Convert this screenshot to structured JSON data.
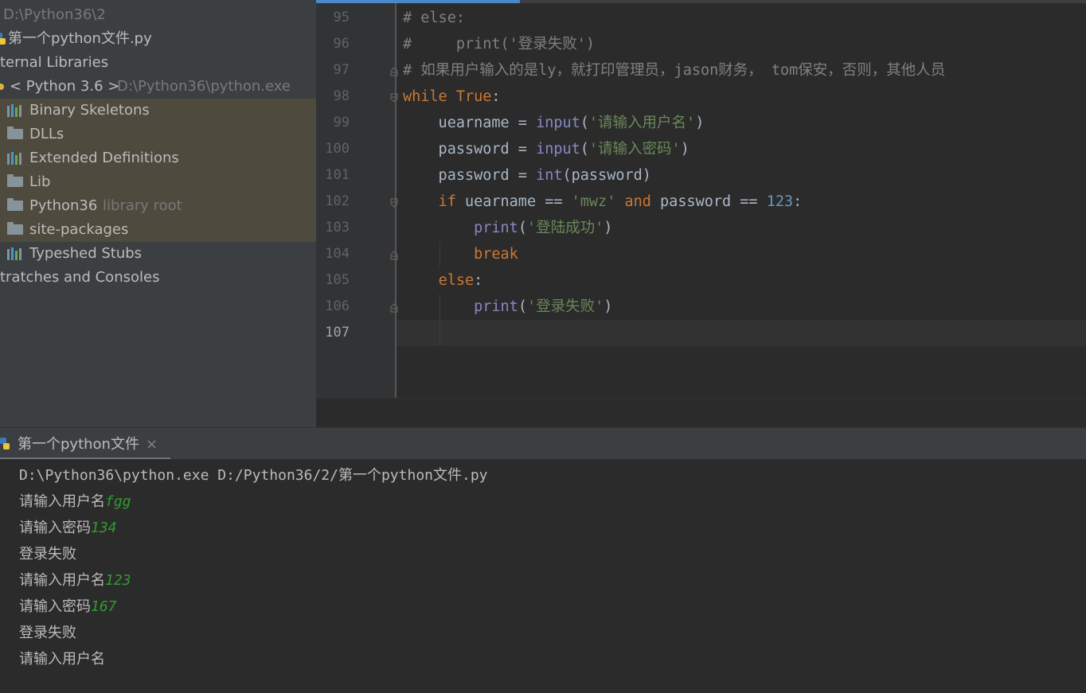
{
  "project_tree": {
    "root_path": "D:\\Python36\\2",
    "file": "第一个python文件.py",
    "external_libraries": "ternal Libraries",
    "sdk": "< Python 3.6 >",
    "sdk_path": "D:\\Python36\\python.exe",
    "items": [
      {
        "label": "Binary Skeletons",
        "icon": "library-icon"
      },
      {
        "label": "DLLs",
        "icon": "folder-icon"
      },
      {
        "label": "Extended Definitions",
        "icon": "library-icon"
      },
      {
        "label": "Lib",
        "icon": "folder-icon"
      },
      {
        "label": "Python36",
        "icon": "folder-icon",
        "hint": "library root"
      },
      {
        "label": "site-packages",
        "icon": "folder-icon"
      },
      {
        "label": "Typeshed Stubs",
        "icon": "library-icon"
      }
    ],
    "scratches": "tratches and Consoles"
  },
  "editor": {
    "line_numbers": [
      "95",
      "96",
      "97",
      "98",
      "99",
      "100",
      "101",
      "102",
      "103",
      "104",
      "105",
      "106",
      "107"
    ],
    "current_line": "107",
    "lines": [
      [
        [
          "cm",
          "# else:"
        ]
      ],
      [
        [
          "cm",
          "#     print('登录失败')"
        ]
      ],
      [
        [
          "cm",
          "# 如果用户输入的是ly，就打印管理员，jason财务， tom保安，否则，其他人员"
        ]
      ],
      [
        [
          "kw",
          "while"
        ],
        [
          "plain",
          " "
        ],
        [
          "kw",
          "True"
        ],
        [
          "plain",
          ":"
        ]
      ],
      [
        [
          "plain",
          "    uearname = "
        ],
        [
          "bi",
          "input"
        ],
        [
          "plain",
          "("
        ],
        [
          "st",
          "'请输入用户名'"
        ],
        [
          "plain",
          ")"
        ]
      ],
      [
        [
          "plain",
          "    password = "
        ],
        [
          "bi",
          "input"
        ],
        [
          "plain",
          "("
        ],
        [
          "st",
          "'请输入密码'"
        ],
        [
          "plain",
          ")"
        ]
      ],
      [
        [
          "plain",
          "    password = "
        ],
        [
          "bi",
          "int"
        ],
        [
          "plain",
          "(password)"
        ]
      ],
      [
        [
          "plain",
          "    "
        ],
        [
          "kw",
          "if"
        ],
        [
          "plain",
          " uearname == "
        ],
        [
          "st",
          "'mwz'"
        ],
        [
          "plain",
          " "
        ],
        [
          "kw",
          "and"
        ],
        [
          "plain",
          " password == "
        ],
        [
          "nu",
          "123"
        ],
        [
          "plain",
          ":"
        ]
      ],
      [
        [
          "plain",
          "        "
        ],
        [
          "bi",
          "print"
        ],
        [
          "plain",
          "("
        ],
        [
          "st",
          "'登陆成功'"
        ],
        [
          "plain",
          ")"
        ]
      ],
      [
        [
          "plain",
          "        "
        ],
        [
          "kw",
          "break"
        ]
      ],
      [
        [
          "plain",
          "    "
        ],
        [
          "kw",
          "else"
        ],
        [
          "plain",
          ":"
        ]
      ],
      [
        [
          "plain",
          "        "
        ],
        [
          "bi",
          "print"
        ],
        [
          "plain",
          "("
        ],
        [
          "st",
          "'登录失败'"
        ],
        [
          "plain",
          ")"
        ]
      ],
      []
    ]
  },
  "run_panel": {
    "tab_label": "第一个python文件",
    "close_glyph": "×",
    "console": [
      {
        "text": "D:\\Python36\\python.exe D:/Python36/2/第一个python文件.py",
        "input": ""
      },
      {
        "text": "请输入用户名",
        "input": "fgg"
      },
      {
        "text": "请输入密码",
        "input": "134"
      },
      {
        "text": "登录失败",
        "input": ""
      },
      {
        "text": "请输入用户名",
        "input": "123"
      },
      {
        "text": "请输入密码",
        "input": "167"
      },
      {
        "text": "登录失败",
        "input": ""
      },
      {
        "text": "请输入用户名",
        "input": ""
      }
    ]
  },
  "colors": {
    "keyword": "#cc7832",
    "builtin": "#8888c6",
    "string": "#6a8759",
    "number": "#6897bb",
    "comment": "#808080",
    "user_input": "#2e9c2e"
  }
}
